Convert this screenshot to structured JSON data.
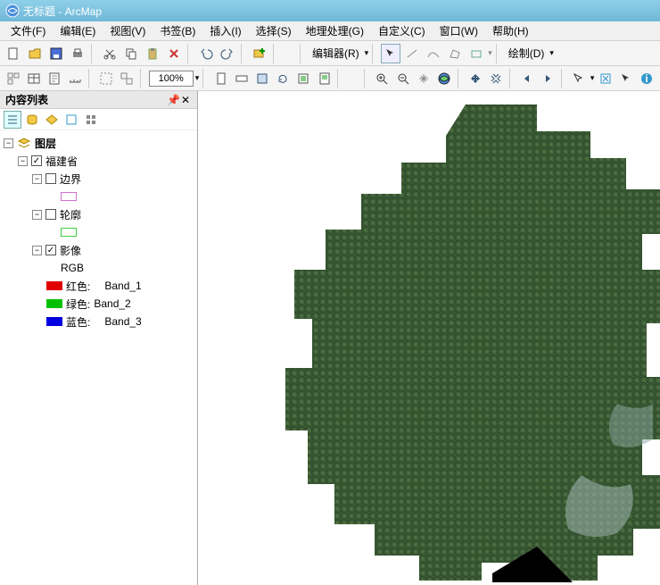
{
  "window": {
    "title": "无标题 - ArcMap"
  },
  "menu": {
    "file": "文件(F)",
    "edit": "编辑(E)",
    "view": "视图(V)",
    "bookmarks": "书签(B)",
    "insert": "插入(I)",
    "selection": "选择(S)",
    "geoprocessing": "地理处理(G)",
    "customize": "自定义(C)",
    "windows": "窗口(W)",
    "help": "帮助(H)"
  },
  "toolbar1": {
    "zoom_value": "100%",
    "editor_label": "编辑器(R)",
    "draw_label": "绘制(D)"
  },
  "toc": {
    "title": "内容列表",
    "root": "图层",
    "layers": [
      {
        "name": "福建省",
        "checked": true
      },
      {
        "name": "边界",
        "checked": false
      },
      {
        "name": "轮廓",
        "checked": false
      },
      {
        "name": "影像",
        "checked": true
      }
    ],
    "rgb_label": "RGB",
    "bands": [
      {
        "color": "#e00000",
        "label": "红色:",
        "band": "Band_1"
      },
      {
        "color": "#00c000",
        "label": "绿色:",
        "band": "Band_2"
      },
      {
        "color": "#0000e0",
        "label": "蓝色:",
        "band": "Band_3"
      }
    ],
    "boundary_swatch": "#d070d0",
    "outline_swatch": "#40d040"
  }
}
